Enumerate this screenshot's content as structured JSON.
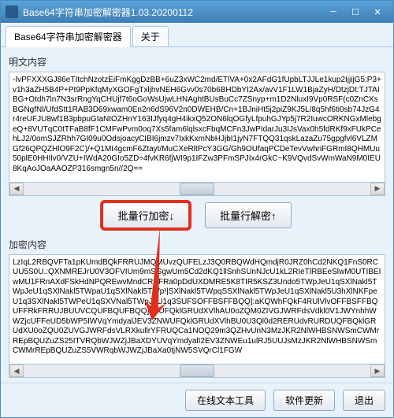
{
  "window": {
    "title": "Base64字符串加密解密器1.03.20200112"
  },
  "tabs": {
    "main": "Base64字符串加密解密器",
    "about": "关于"
  },
  "labels": {
    "plain": "明文内容",
    "encrypted": "加密内容"
  },
  "plain_text": "-IvPFXXXGJ86eTItchNzotzEiFmKggDzBB+6uZ3xWC2md/ETlVA+0x2AFdG1fUpbLTJJLe1kup2IjjijG5:P3+v1h3aZH5B4P+Pt9PpKfqMyXGOFgTxljhvNEH6Gvv0s70b6BHDbYI2Ax/avV1F1LW1BjaZyH/DtzjDt:TJTAIBG+Otdh7ln7N3srRngYqCHUjf7t6oGoWsUjwLHNAghtBUsBuCc7ZSnyp+m1D2NluxI9Vp0RSF(c0ZnCXsBGNgfNl/UfdStt1RAB3D69xwam0En2n6dS96V2n0DWEHB/Cn+1BJniHt5j2piZ9KJ5L/8q5hf6ti0sb74JzG4r4reUFJU8wf1B3pbpuGIaNtOZHnY163IJfyq4gH4ikxQ52ON6lqOGfyLfpuhGJYp5j7R2IuwcORKNGxMlebgeQ+8VUTqC0tTFaB8fF1CMFwPvm0oq7Xs5fam6lqlsxcFbqMCFn3JwPIdarJu3IJsVax0h5fdRKf9xFUkPCehLJ2/0omSJZRhh7GI09u0OdsjoacyCIBI6jmzv7IxkKxmNbHJjbI1jyN7FTQQ31qskLazaZu75gpgfvl6VLZMGf26QPQZHlO9F2C)/+Q1MI4gcmF6Ztayt/MuCXeRltPcY3GG/Gh9OUfaqPCDeTevVwhriFGRmI8QHMUu50plE0HHIlv0/VZU+IWdA20GIo5ZD÷4fvKR6fjWI9p1IFZw3PFmSPJIx4rGkC~K9VQvdSvWmWaN9M0IEU8KqAoJOaAAOZP316smgn5n//2Q==",
  "encrypted_text": "LzIqL2RBQVFTa1pKUmdBQkFRRUJMQMUvzQUFELzJ3Q0RBQWdHQmdjR0JRZ0hCd2NKQ1FnS0RCUU5S0U.:QXNMREJrU0V3OFVIUm9mSGgwUm5Cd2dKQ1llSnhSUnNJcU1kL2RIeTlRBEeSlwM0UTIBEIwMU1FRnAXdFSkHdNPQREwvMndCREFRa0pDdUXDMRE5K8TIR5KSZ3Undo5TWpJeU1qSXlNakl5TWpJeU1qSXlNakl5TWpaU1qSXlNakl5TWp!|SXlNakl5TWpqSSXlNakl5TWpJeU1qSXlNakl5U3hXlNKFpeU1q3SXlNakl5TWPeU1qSXVNal5TWpJeU1q3SUFSOFFBSFFBQQ]:aKQWhFQkF4RUlVlvOFFBSFFBQUFFRkFRRUJBUUVCQUFBQUFBQQ]:WUFQklGRUdXVlhAU0oZQM0ZIVGJWRFdsVdkl0V1JWYnhhWWZjcUFFeUD5bWP5IWVqYmdyalJEV3ZNWUFQklGRUdXVlhBU0U3Ql0d2RERUdvRURDUQFBQklGRUdXU0oZQU0ZUVGJWRFdsVLRXkullrYFRUQCa1NOQ29m3QZHvUnN3MzJKR2NlWHBSNWSmCWMrREpBQUZuZS25ITVRQbWJWZjJBaXDYUVqYmdyalI2EV3ZNWEu1ulRJ5UUJsMzJKR2NlWHBSNWSmCWMrREpBQUZuZS5VWRqbWJWZjJBaXa0tjNW5SVQrCl1FGW",
  "buttons": {
    "encrypt": "批量行加密↓",
    "decrypt": "批量行解密↑",
    "online_tool": "在线文本工具",
    "update": "软件更新",
    "exit": "退出"
  }
}
